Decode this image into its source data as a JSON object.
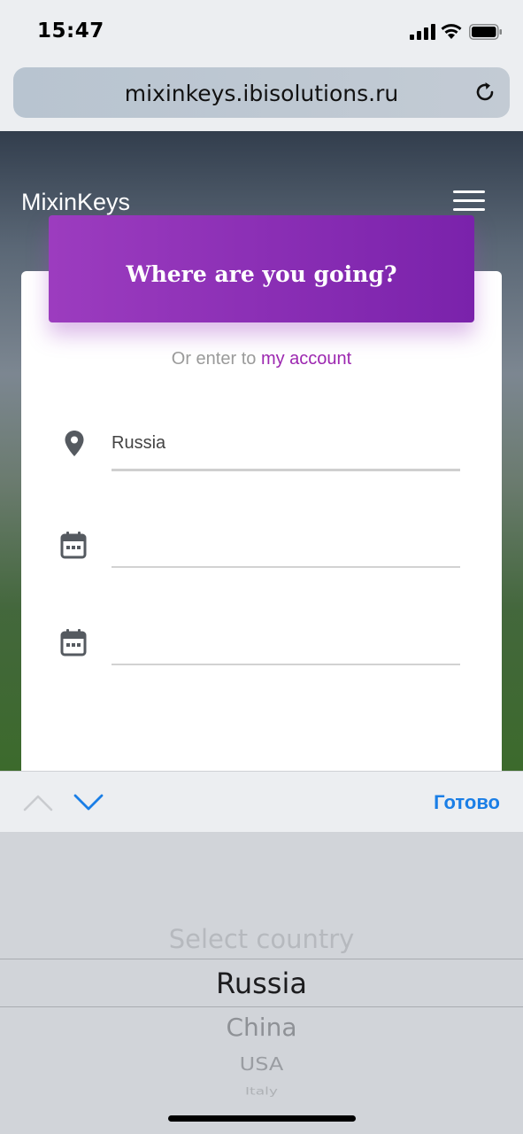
{
  "status_bar": {
    "time": "15:47"
  },
  "browser": {
    "url": "mixinkeys.ibisolutions.ru"
  },
  "site": {
    "brand": "MixinKeys"
  },
  "card": {
    "title": "Where are you going?",
    "account_prefix": "Or enter to",
    "account_link": "my account",
    "fields": {
      "destination_value": "Russia",
      "start_date_value": "",
      "end_date_value": ""
    }
  },
  "keyboard_toolbar": {
    "done_label": "Готово"
  },
  "picker": {
    "options": [
      "Select country",
      "Russia",
      "China",
      "USA",
      "Italy"
    ],
    "selected": "Russia"
  },
  "colors": {
    "accent": "#9c27b0",
    "ios_blue": "#1a7ee6"
  }
}
